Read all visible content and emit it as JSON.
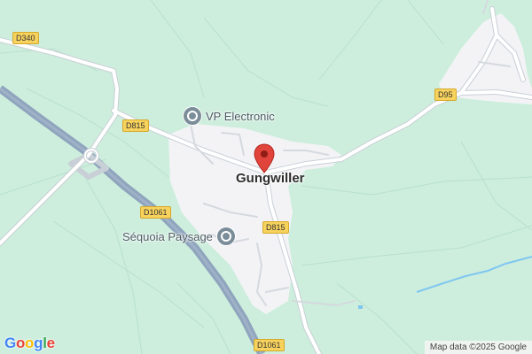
{
  "map": {
    "town_name": "Gungwiller",
    "road_labels": {
      "d340": "D340",
      "d815_west": "D815",
      "d95": "D95",
      "d1061_upper": "D1061",
      "d815_south": "D815",
      "d1061_lower": "D1061"
    },
    "places": {
      "vp_electronic": "VP Electronic",
      "sequoia_paysage": "Séquoia Paysage"
    },
    "attribution": "Map data ©2025 Google",
    "logo_text": "Google",
    "colors": {
      "land": "#cdeedd",
      "built_area": "#f3f3f6",
      "motorway": "#8fa4bd",
      "road": "#ffffff",
      "water": "#7fc6f0",
      "pin": "#e0443a"
    }
  }
}
